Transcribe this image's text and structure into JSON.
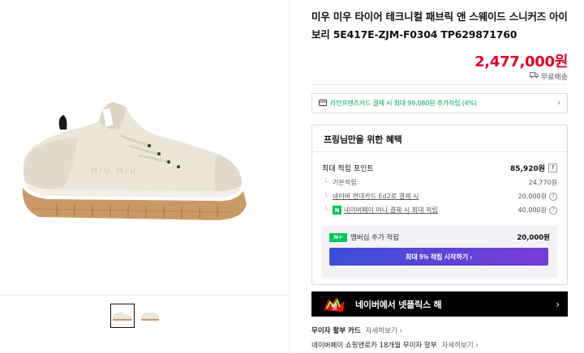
{
  "product": {
    "title": "미우 미우 타이어 테크니컬 패브릭 앤 스웨이드 스니커즈 아이보리 5E417E-ZJM-F0304 TP629871760",
    "price": "2,477,000원",
    "shipping": "무료배송"
  },
  "card_offer": {
    "text": "라인프렌즈카드 결제 시 최대 99,080원 추가적립 (4%)",
    "chevron": "›"
  },
  "benefits": {
    "heading": "프링님만을 위한 혜택",
    "total_label": "최대 적립 포인트",
    "total_value": "85,920원",
    "help": "?",
    "rows": [
      {
        "label": "기본적립",
        "value": "24,770원"
      },
      {
        "label": "네이버 현대카드 Ed2로 결제 시",
        "value": "20,000원"
      },
      {
        "label": "네이버페이 머니 결제 시 최대 적립",
        "value": "40,000원"
      }
    ],
    "membership": {
      "badge": "N+",
      "label": "멤버십 추가 적립",
      "value": "20,000원",
      "button": "최대 5% 적립 시작하기 ›"
    }
  },
  "netflix": {
    "logo": "넷",
    "text": "네이버에서 넷플릭스 해",
    "chevron": "›"
  },
  "installments": [
    {
      "label": "무이자 할부 카드",
      "more": "자세히보기"
    },
    {
      "label": "네이버페이 쇼핑앤로카 18개월 무이자 할부",
      "more": "자세히보기"
    }
  ],
  "colors": {
    "price": "#e0002a",
    "naver_green": "#03c75a",
    "button_gradient_start": "#3b4fd8",
    "button_gradient_end": "#7a3cd6"
  },
  "icons": {
    "shipping": "truck-icon",
    "card": "credit-card-icon",
    "help": "question-icon",
    "netflix": "netflix-logo"
  }
}
